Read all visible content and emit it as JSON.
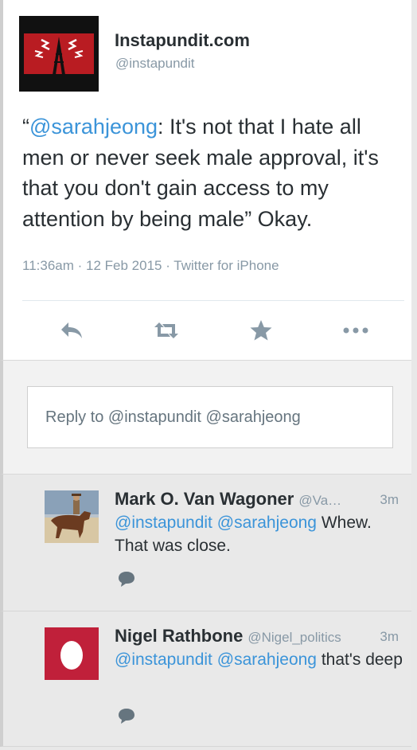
{
  "tweet": {
    "name": "Instapundit.com",
    "handle": "@instapundit",
    "open_quote": "“",
    "mention": "@sarahjeong",
    "body": ": It's not that I hate all men or never seek male approval, it's that you don't gain access to my attention by being male” Okay.",
    "time": "11:36am",
    "date": "12 Feb 2015",
    "source": "Twitter for iPhone"
  },
  "actions": [
    "reply-icon",
    "retweet-icon",
    "favorite-icon",
    "more-icon"
  ],
  "reply": {
    "placeholder": "Reply to @instapundit @sarahjeong"
  },
  "replies": [
    {
      "name": "Mark O. Van Wagoner",
      "handle": "@Va…",
      "time": "3m",
      "mention1": "@instapundit",
      "mention2": "@sarahjeong",
      "text": " Whew. That was close."
    },
    {
      "name": "Nigel Rathbone",
      "handle": "@Nigel_politics",
      "time": "3m",
      "mention1": "@instapundit",
      "mention2": "@sarahjeong",
      "text": " that's deep"
    }
  ],
  "colors": {
    "link": "#3b94d9",
    "muted": "#8899a6",
    "egg_bg": "#c0203a"
  }
}
